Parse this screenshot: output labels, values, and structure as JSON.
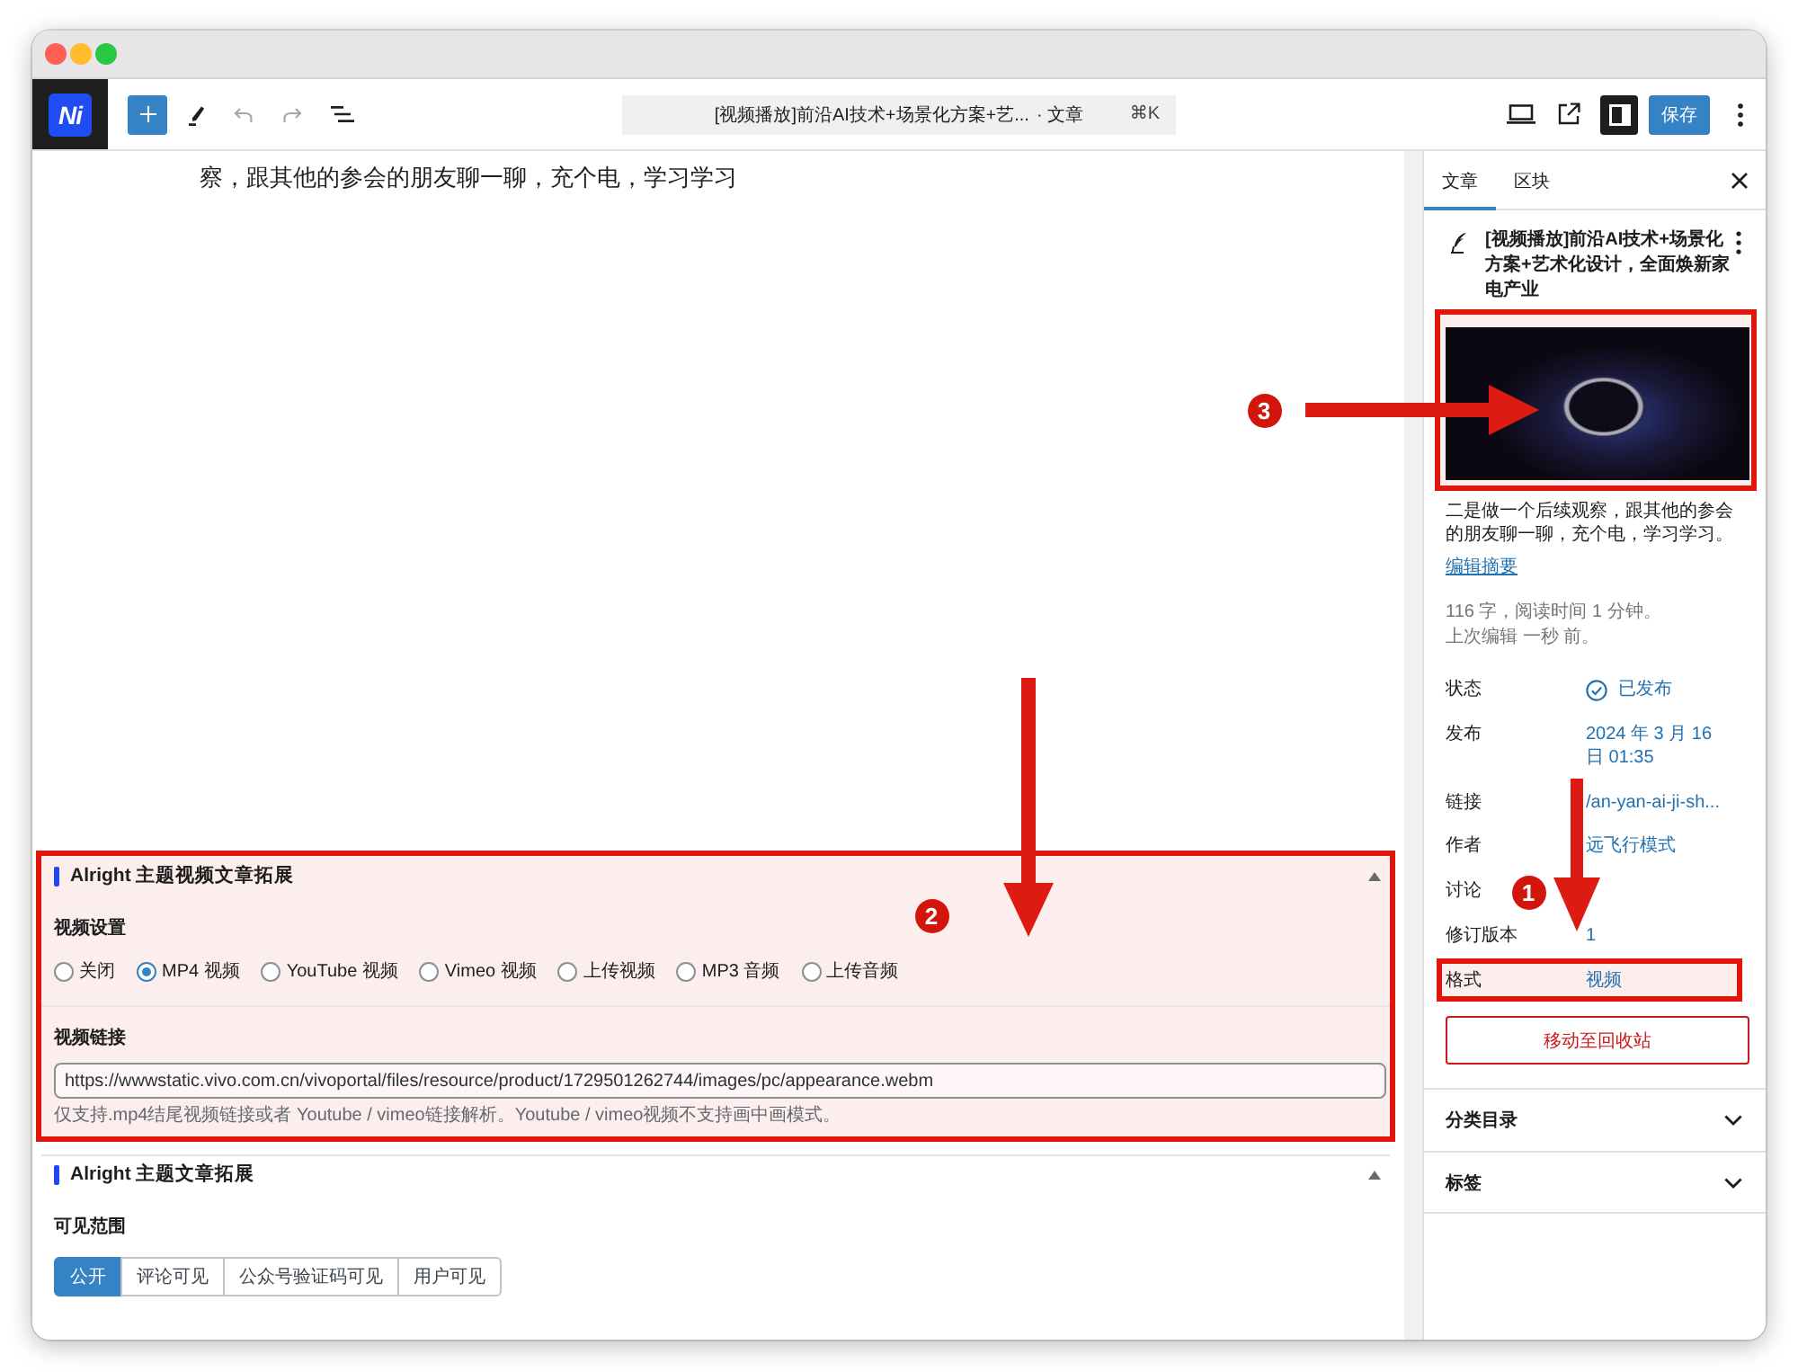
{
  "toolbar": {
    "logo": "Ni",
    "undo": {
      "disabled": true
    },
    "redo": {
      "disabled": true
    },
    "command_bar": {
      "title": "[视频播放]前沿AI技术+场景化方案+艺...",
      "post_type": "· 文章",
      "shortcut": "⌘K"
    },
    "sidebar_toggle": {
      "pressed": true
    },
    "save_button": "保存"
  },
  "editor": {
    "paragraph": "察，跟其他的参会的朋友聊一聊，充个电，学习学习",
    "meta_boxes": [
      {
        "title": "Alright 主题视频文章拓展",
        "highlighted": true,
        "expanded": true,
        "fields": [
          {
            "kind": "radio",
            "label": "视频设置",
            "options": [
              {
                "label": "关闭",
                "selected": false
              },
              {
                "label": "MP4 视频",
                "selected": true
              },
              {
                "label": "YouTube 视频",
                "selected": false
              },
              {
                "label": "Vimeo 视频",
                "selected": false
              },
              {
                "label": "上传视频",
                "selected": false
              },
              {
                "label": "MP3 音频",
                "selected": false
              },
              {
                "label": "上传音频",
                "selected": false
              }
            ]
          },
          {
            "kind": "text",
            "label": "视频链接",
            "value": "https://wwwstatic.vivo.com.cn/vivoportal/files/resource/product/1729501262744/images/pc/appearance.webm",
            "help": "仅支持.mp4结尾视频链接或者 Youtube / vimeo链接解析。Youtube / vimeo视频不支持画中画模式。"
          }
        ]
      },
      {
        "title": "Alright 主题文章拓展",
        "highlighted": false,
        "expanded": true,
        "fields": [
          {
            "kind": "segmented",
            "label": "可见范围",
            "options": [
              {
                "label": "公开",
                "selected": true
              },
              {
                "label": "评论可见",
                "selected": false
              },
              {
                "label": "公众号验证码可见",
                "selected": false
              },
              {
                "label": "用户可见",
                "selected": false
              }
            ]
          }
        ]
      }
    ]
  },
  "sidebar": {
    "tabs": [
      {
        "label": "文章",
        "selected": true
      },
      {
        "label": "区块",
        "selected": false
      }
    ],
    "post": {
      "title": "[视频播放]前沿AI技术+场景化方案+艺术化设计，全面焕新家电产业",
      "featured_image": {
        "highlighted": true
      },
      "excerpt": "二是做一个后续观察，跟其他的参会的朋友聊一聊，充个电，学习学习。",
      "edit_excerpt": "编辑摘要",
      "stats": "116 字，阅读时间 1 分钟。",
      "last_edited": "上次编辑 一秒 前。"
    },
    "fields": [
      {
        "kind": "status",
        "label": "状态",
        "value": "已发布",
        "highlighted": false
      },
      {
        "kind": "date",
        "label": "发布",
        "value": "2024 年 3 月 16 日 01:35",
        "highlighted": false
      },
      {
        "kind": "link",
        "label": "链接",
        "value": "/an-yan-ai-ji-sh...",
        "highlighted": false
      },
      {
        "kind": "link",
        "label": "作者",
        "value": "远飞行模式",
        "highlighted": false
      },
      {
        "label": "讨论",
        "highlighted": false
      },
      {
        "kind": "link",
        "label": "修订版本",
        "value": "1",
        "highlighted": false
      },
      {
        "kind": "link",
        "label": "格式",
        "value": "视频",
        "highlighted": true
      }
    ],
    "trash_button": "移动至回收站",
    "panels": [
      {
        "title": "分类目录",
        "expanded": false
      },
      {
        "title": "标签",
        "expanded": false
      }
    ]
  },
  "annotations": [
    {
      "number": "1"
    },
    {
      "number": "2"
    },
    {
      "number": "3"
    }
  ]
}
